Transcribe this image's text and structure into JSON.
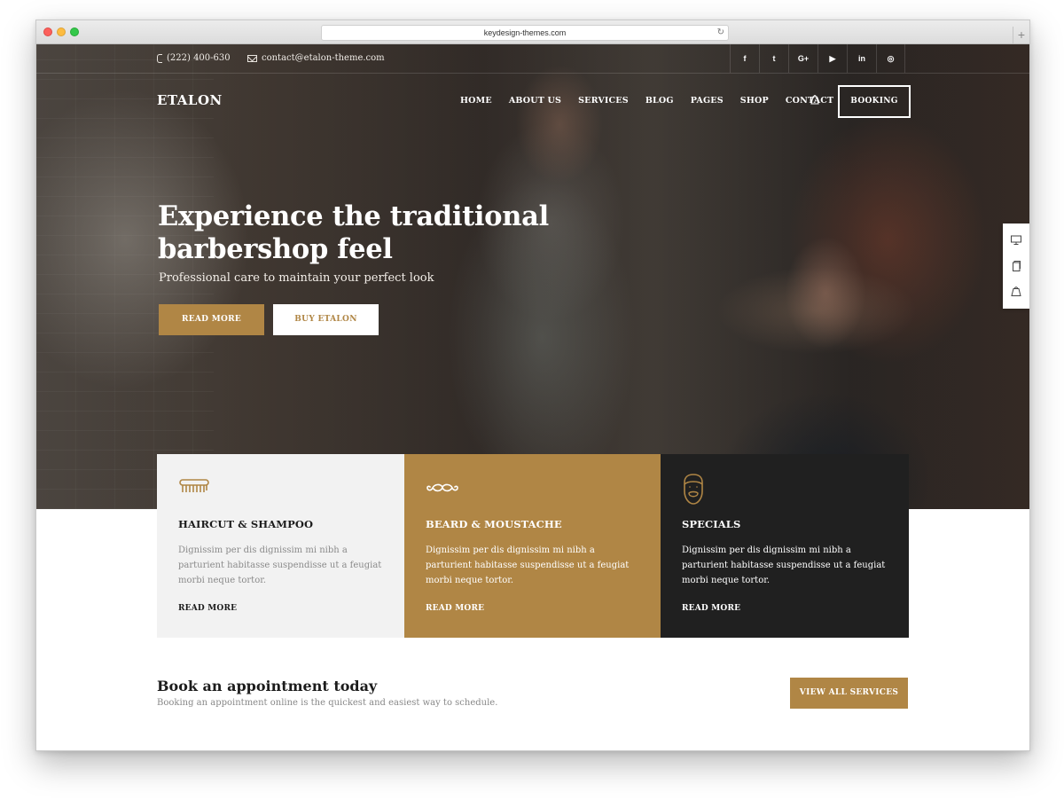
{
  "browser": {
    "url": "keydesign-themes.com",
    "reload_icon": "↻",
    "newtab_icon": "+"
  },
  "topbar": {
    "phone": "(222) 400-630",
    "email": "contact@etalon-theme.com",
    "socials": [
      {
        "icon": "facebook-icon",
        "label": "f"
      },
      {
        "icon": "twitter-icon",
        "label": "t"
      },
      {
        "icon": "google-plus-icon",
        "label": "G+"
      },
      {
        "icon": "youtube-icon",
        "label": "▶"
      },
      {
        "icon": "linkedin-icon",
        "label": "in"
      },
      {
        "icon": "instagram-icon",
        "label": "◎"
      }
    ]
  },
  "header": {
    "logo": "ETALON",
    "nav": [
      "HOME",
      "ABOUT US",
      "SERVICES",
      "BLOG",
      "PAGES",
      "SHOP",
      "CONTACT"
    ],
    "booking": "BOOKING"
  },
  "hero": {
    "title": "Experience the traditional barbershop feel",
    "subtitle": "Professional care to maintain your perfect look",
    "primary_button": "READ MORE",
    "secondary_button": "BUY ETALON"
  },
  "cards": [
    {
      "icon": "comb-icon",
      "title": "HAIRCUT & SHAMPOO",
      "text": "Dignissim per dis dignissim mi nibh a parturient habitasse suspendisse ut a feugiat morbi neque tortor.",
      "link": "READ MORE"
    },
    {
      "icon": "moustache-icon",
      "title": "BEARD & MOUSTACHE",
      "text": "Dignissim per dis dignissim mi nibh a parturient habitasse suspendisse ut a feugiat morbi neque tortor.",
      "link": "READ MORE"
    },
    {
      "icon": "bearded-face-icon",
      "title": "SPECIALS",
      "text": "Dignissim per dis dignissim mi nibh a parturient habitasse suspendisse ut a feugiat morbi neque tortor.",
      "link": "READ MORE"
    }
  ],
  "appointment": {
    "title": "Book an appointment today",
    "subtitle": "Booking an appointment online is the quickest and easiest way to schedule.",
    "button": "VIEW ALL SERVICES"
  },
  "colors": {
    "accent": "#b08645",
    "dark": "#202020",
    "light_card": "#f2f2f2"
  }
}
